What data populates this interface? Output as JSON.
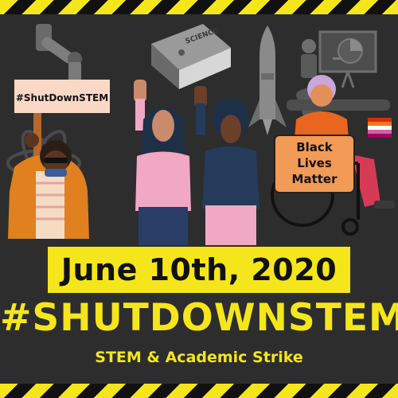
{
  "colors": {
    "accent": "#f5e61c",
    "background": "#2d2d2d",
    "stripe_dark": "#111111"
  },
  "sign_left": {
    "text": "#ShutDownSTEM"
  },
  "sign_right": {
    "line1": "Black",
    "line2": "Lives",
    "line3": "Matter"
  },
  "book": {
    "label": "SCIENCE"
  },
  "date": {
    "text": "June 10th, 2020"
  },
  "headline": {
    "text": "#SHUTDOWNSTEM"
  },
  "subline": {
    "text": "STEM & Academic Strike"
  },
  "icons": [
    "robot-arm-icon",
    "science-book-icon",
    "rocket-icon",
    "presentation-board-icon",
    "microscope-icon",
    "atom-icon",
    "wheelchair-icon",
    "pride-flag-icon"
  ]
}
